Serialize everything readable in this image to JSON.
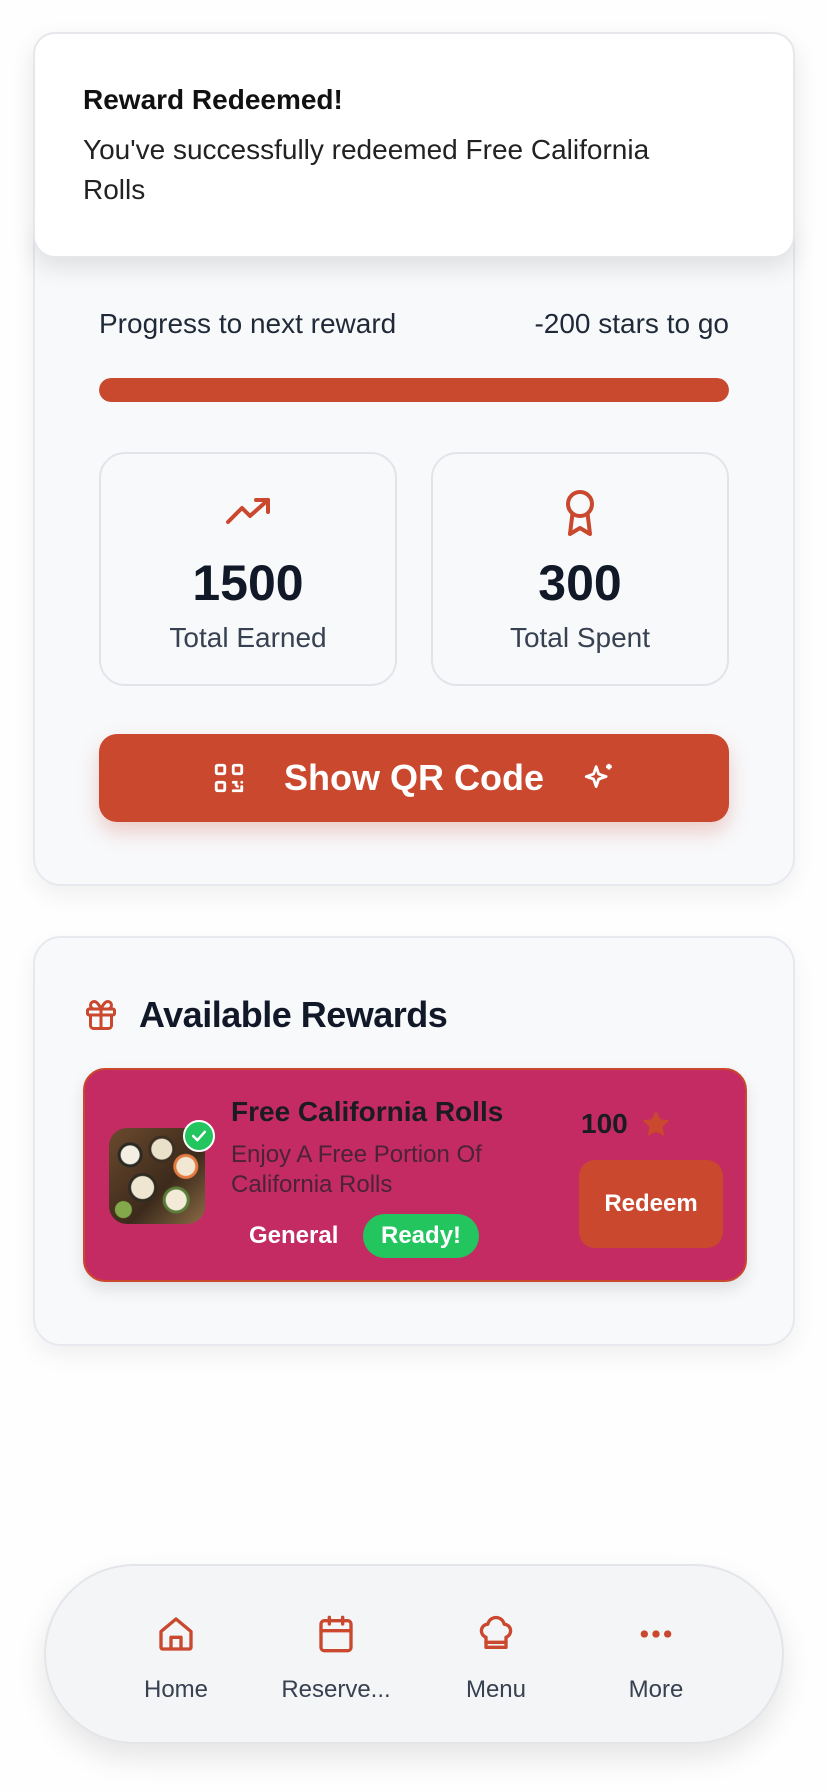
{
  "toast": {
    "title": "Reward Redeemed!",
    "message": "You've successfully redeemed Free California Rolls"
  },
  "progress": {
    "label": "Progress to next reward",
    "remaining": "-200 stars to go",
    "fill_fraction": 1.0
  },
  "stats": {
    "earned": {
      "value": "1500",
      "label": "Total Earned",
      "icon": "trending-up-icon"
    },
    "spent": {
      "value": "300",
      "label": "Total Spent",
      "icon": "award-icon"
    }
  },
  "qr_button": {
    "label": "Show QR Code",
    "icon_left": "qr-code-icon",
    "icon_right": "sparkles-icon"
  },
  "rewards": {
    "title": "Available Rewards",
    "icon": "gift-icon",
    "items": [
      {
        "name": "Free California Rolls",
        "description": "Enjoy A Free Portion Of California Rolls",
        "category": "General",
        "status": "Ready!",
        "cost": "100",
        "action": "Redeem"
      }
    ]
  },
  "nav": {
    "items": [
      {
        "label": "Home",
        "icon": "home-icon"
      },
      {
        "label": "Reserve...",
        "icon": "calendar-icon"
      },
      {
        "label": "Menu",
        "icon": "chef-hat-icon"
      },
      {
        "label": "More",
        "icon": "more-dots-icon"
      }
    ]
  },
  "colors": {
    "accent": "#c9482e",
    "reward_card": "#c42b63",
    "success": "#22c55e"
  }
}
